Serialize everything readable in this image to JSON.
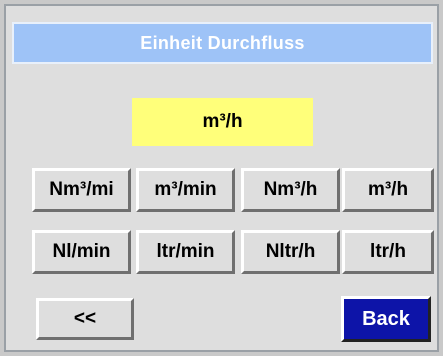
{
  "header": {
    "title": "Einheit Durchfluss"
  },
  "current": {
    "value": "m³/h"
  },
  "units_row1": [
    "Nm³/mi",
    "m³/min",
    "Nm³/h",
    "m³/h"
  ],
  "units_row2": [
    "Nl/min",
    "ltr/min",
    "Nltr/h",
    "ltr/h"
  ],
  "nav": {
    "prev_label": "<<",
    "back_label": "Back"
  },
  "colors": {
    "header_bg": "#9ec3f7",
    "current_bg": "#ffff7a",
    "back_bg": "#0d14a8"
  }
}
